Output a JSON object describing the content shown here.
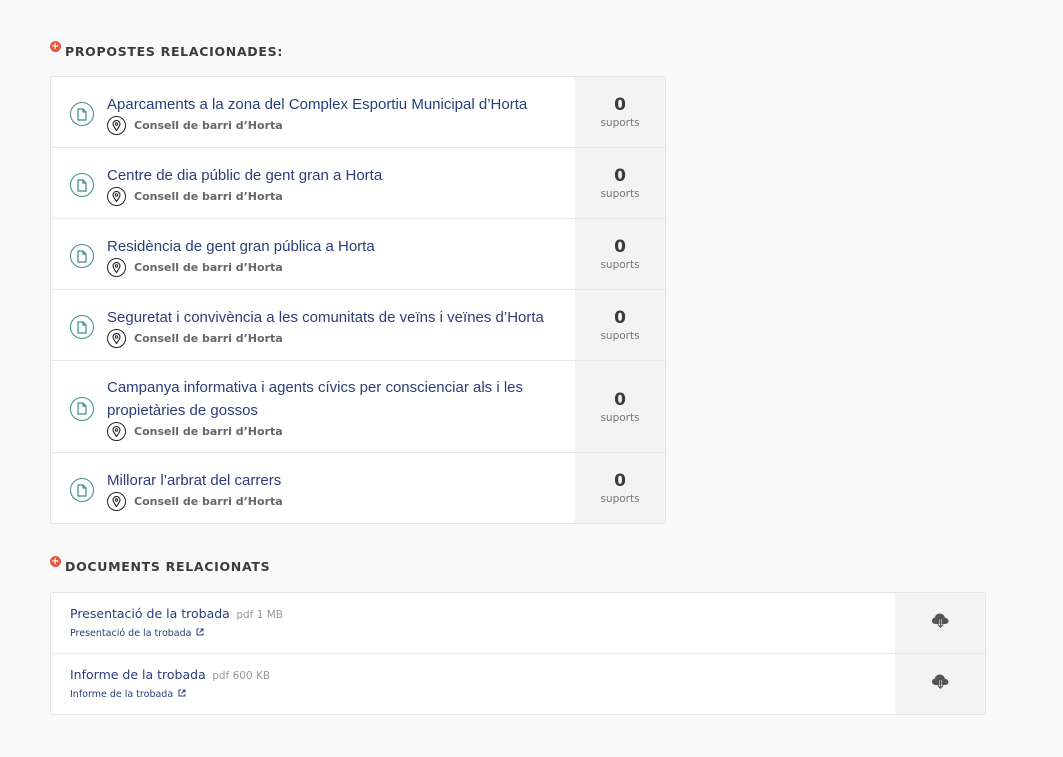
{
  "proposals_section": {
    "title": "PROPOSTES RELACIONADES:",
    "icon": "plus-circle-icon",
    "items": [
      {
        "title": "Aparcaments a la zona del Complex Esportiu Municipal d’Horta",
        "scope": "Consell de barri d’Horta",
        "supports_count": "0",
        "supports_label": "suports"
      },
      {
        "title": "Centre de dia públic de gent gran a Horta",
        "scope": "Consell de barri d’Horta",
        "supports_count": "0",
        "supports_label": "suports"
      },
      {
        "title": "Residència de gent gran pública a Horta",
        "scope": "Consell de barri d’Horta",
        "supports_count": "0",
        "supports_label": "suports"
      },
      {
        "title": "Seguretat i convivència a les comunitats de veïns i veïnes d’Horta",
        "scope": "Consell de barri d’Horta",
        "supports_count": "0",
        "supports_label": "suports"
      },
      {
        "title": "Campanya informativa i agents cívics per conscienciar als i les propietàries de gossos",
        "scope": "Consell de barri d’Horta",
        "supports_count": "0",
        "supports_label": "suports"
      },
      {
        "title": "Millorar l’arbrat del carrers",
        "scope": "Consell de barri d’Horta",
        "supports_count": "0",
        "supports_label": "suports"
      }
    ]
  },
  "documents_section": {
    "title": "DOCUMENTS RELACIONATS",
    "icon": "plus-circle-icon",
    "items": [
      {
        "title": "Presentació de la trobada",
        "meta": "pdf 1 MB",
        "link_text": "Presentació de la trobada"
      },
      {
        "title": "Informe de la trobada",
        "meta": "pdf 600 KB",
        "link_text": "Informe de la trobada"
      }
    ]
  },
  "colors": {
    "accent_red": "#e8573f",
    "link_blue": "#2b3d7a",
    "icon_teal": "#3b8c86",
    "background": "#f9f9f9"
  }
}
